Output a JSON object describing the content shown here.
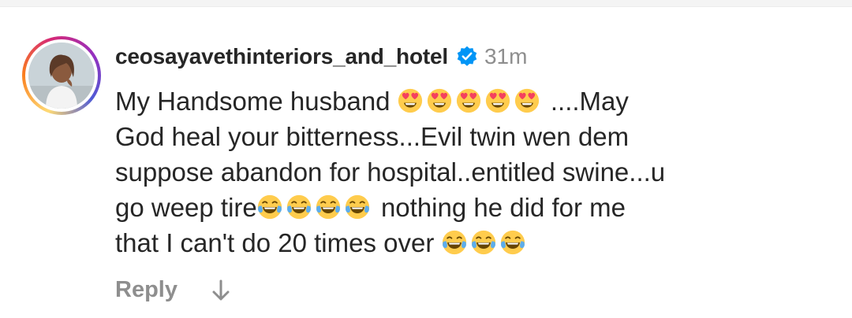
{
  "comment": {
    "username": "ceosayavethinteriors_and_hotel",
    "time": "31m",
    "lines": [
      {
        "segments": [
          {
            "t": "text",
            "v": "My Handsome husband "
          },
          {
            "t": "emoji",
            "v": "heart-eyes"
          },
          {
            "t": "emoji",
            "v": "heart-eyes"
          },
          {
            "t": "emoji",
            "v": "heart-eyes"
          },
          {
            "t": "emoji",
            "v": "heart-eyes"
          },
          {
            "t": "emoji",
            "v": "heart-eyes"
          },
          {
            "t": "text",
            "v": " ....May"
          }
        ]
      },
      {
        "segments": [
          {
            "t": "text",
            "v": "God heal your bitterness...Evil twin wen dem"
          }
        ]
      },
      {
        "segments": [
          {
            "t": "text",
            "v": "suppose abandon for hospital..entitled swine...u"
          }
        ]
      },
      {
        "segments": [
          {
            "t": "text",
            "v": "go weep tire"
          },
          {
            "t": "emoji",
            "v": "tears-of-joy"
          },
          {
            "t": "emoji",
            "v": "tears-of-joy"
          },
          {
            "t": "emoji",
            "v": "tears-of-joy"
          },
          {
            "t": "emoji",
            "v": "tears-of-joy"
          },
          {
            "t": "text",
            "v": " nothing he did for me"
          }
        ]
      },
      {
        "segments": [
          {
            "t": "text",
            "v": "that I can't do 20 times over "
          },
          {
            "t": "emoji",
            "v": "tears-of-joy"
          },
          {
            "t": "emoji",
            "v": "tears-of-joy"
          },
          {
            "t": "emoji",
            "v": "tears-of-joy"
          }
        ]
      }
    ],
    "reply_label": "Reply"
  },
  "icons": {
    "verified": "verified-badge-icon",
    "reply_arrow": "arrow-down-icon",
    "avatar": "profile-photo"
  },
  "colors": {
    "text": "#262626",
    "muted": "#8e8e8e",
    "verified": "#0095f6"
  }
}
